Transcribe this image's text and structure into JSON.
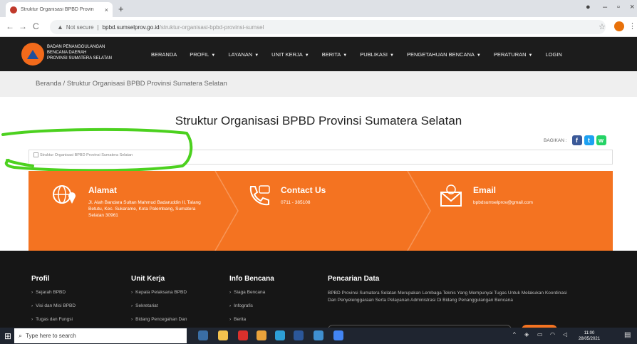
{
  "browser": {
    "tab_title": "Struktur Organisasi BPBD Provin",
    "tab_close": "×",
    "new_tab": "+",
    "minimize": "–",
    "restore": "▫",
    "close": "×",
    "back": "←",
    "forward": "→",
    "reload": "C",
    "security_label": "Not secure",
    "url_host": "bpbd.sumselprov.go.id",
    "url_path": "/struktur-organisasi-bpbd-provinsi-sumsel",
    "bookmark": "☆",
    "menu": "⋮"
  },
  "site": {
    "org_lines": [
      "BADAN PENANGGULANGAN",
      "BENCANA DAERAH",
      "PROVINSI SUMATERA SELATAN"
    ],
    "menu": [
      {
        "label": "BERANDA",
        "dropdown": false
      },
      {
        "label": "PROFIL",
        "dropdown": true
      },
      {
        "label": "LAYANAN",
        "dropdown": true
      },
      {
        "label": "UNIT KERJA",
        "dropdown": true
      },
      {
        "label": "BERITA",
        "dropdown": true
      },
      {
        "label": "PUBLIKASI",
        "dropdown": true
      },
      {
        "label": "PENGETAHUAN BENCANA",
        "dropdown": true
      },
      {
        "label": "PERATURAN",
        "dropdown": true
      },
      {
        "label": "LOGIN",
        "dropdown": false
      }
    ],
    "caret": "▼"
  },
  "breadcrumb": "Beranda / Struktur Organisasi BPBD Provinsi Sumatera Selatan",
  "page_title": "Struktur Organisasi BPBD Provinsi Sumatera Selatan",
  "share": {
    "label": "BAGIKAN :",
    "facebook": "f",
    "twitter": "t",
    "whatsapp": "w"
  },
  "image_alt": "Struktur Organisasi BPBD Provinsi Sumatera Selatan",
  "contact": {
    "address": {
      "title": "Alamat",
      "text": "Jl. Alah Bandara Sultan Mahmud Badaruddin II, Talang Betutu, Kec. Sukarame, Kota Palembang, Sumatera Selatan 30961",
      "icon": "globe-pin-icon"
    },
    "phone": {
      "title": "Contact Us",
      "text": "0711 - 385108",
      "icon": "phone-icon"
    },
    "email": {
      "title": "Email",
      "text": "bpbdsumselprov@gmail.com",
      "icon": "mail-icon"
    }
  },
  "footer": {
    "profil": {
      "title": "Profil",
      "links": [
        "Sejarah BPBD",
        "Visi dan Misi BPBD",
        "Tugas dan Fungsi"
      ]
    },
    "unit_kerja": {
      "title": "Unit Kerja",
      "links": [
        "Kepala Pelaksana BPBD",
        "Sekretariat",
        "Bidang Pencegahan Dan"
      ]
    },
    "info_bencana": {
      "title": "Info Bencana",
      "links": [
        "Siaga Bencana",
        "Infografis",
        "Berita"
      ]
    },
    "pencarian": {
      "title": "Pencarian Data",
      "description": "BPBD Provinsi Sumatera Selatan Merupakan Lembaga Teknis Yang Mempunyai Tugas Untuk Melakukan Koordinasi Dan Penyelenggaraan Serta Pelayanan Administrasi Di Bidang Penanggulangan Bencana"
    }
  },
  "taskbar": {
    "search_placeholder": "Type here to search",
    "time": "11:00",
    "date": "28/05/2021"
  },
  "colors": {
    "accent": "#f47321",
    "nav": "#1c1c1c",
    "footer": "#161616",
    "annotation": "#4cd11f"
  }
}
